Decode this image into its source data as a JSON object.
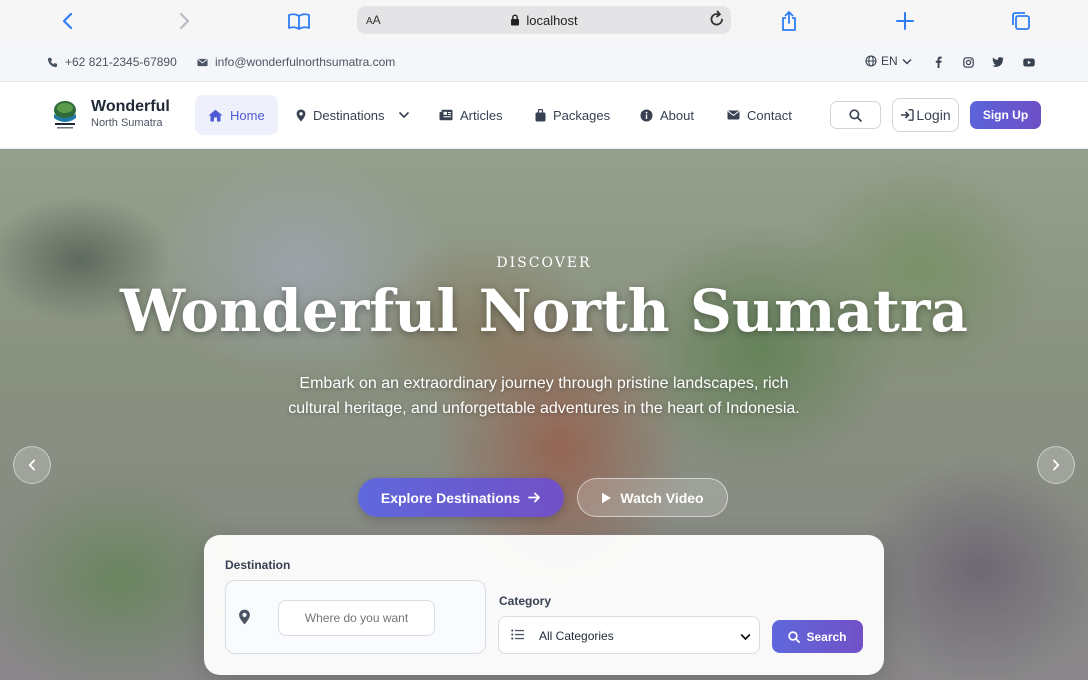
{
  "browser": {
    "text_size_label": "AA",
    "url": "localhost"
  },
  "topbar": {
    "phone": "+62 821-2345-67890",
    "email": "info@wonderfulnorthsumatra.com",
    "language": "EN"
  },
  "brand": {
    "title": "Wonderful",
    "subtitle": "North Sumatra"
  },
  "nav": {
    "home": "Home",
    "destinations": "Destinations",
    "articles": "Articles",
    "packages": "Packages",
    "about": "About",
    "contact": "Contact",
    "login": "Login",
    "signup": "Sign Up"
  },
  "hero": {
    "eyebrow": "DISCOVER",
    "title": "Wonderful North Sumatra",
    "description": "Embark on an extraordinary journey through pristine landscapes, rich cultural heritage, and unforgettable adventures in the heart of Indonesia.",
    "explore_label": "Explore Destinations",
    "watch_label": "Watch Video"
  },
  "search": {
    "destination_label": "Destination",
    "destination_placeholder": "Where do you want",
    "category_label": "Category",
    "category_value": "All Categories",
    "button_label": "Search"
  },
  "colors": {
    "accent": "#5f68dc",
    "accent_end": "#7250c6",
    "safari_blue": "#2f7cf6"
  }
}
